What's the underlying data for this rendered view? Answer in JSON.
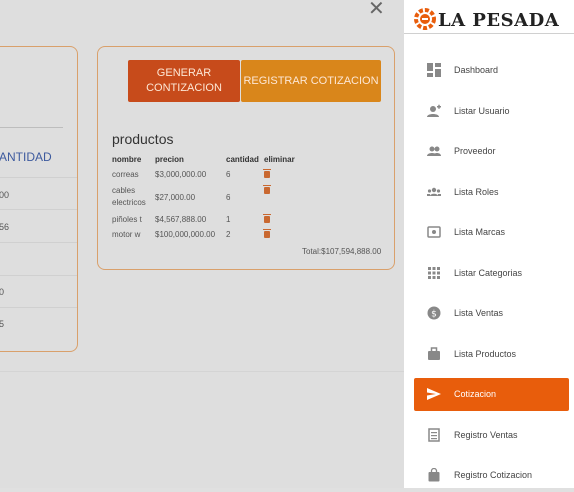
{
  "left_card": {
    "header": "ANTIDAD",
    "cells": [
      "00",
      "56",
      "",
      "0",
      "5"
    ]
  },
  "cotizacion": {
    "generate_label_1": "GENERAR",
    "generate_label_2": "CONTIZACION",
    "register_label": "REGISTRAR COTIZACION",
    "products_title": "productos",
    "columns": [
      "nombre",
      "precion",
      "cantidad",
      "eliminar"
    ],
    "rows": [
      {
        "name": "correas",
        "price": "$3,000,000.00",
        "qty": "6"
      },
      {
        "name": "cables electricos",
        "price": "$27,000.00",
        "qty": "6"
      },
      {
        "name": "piñoles t",
        "price": "$4,567,888.00",
        "qty": "1"
      },
      {
        "name": "motor w",
        "price": "$100,000,000.00",
        "qty": "2"
      }
    ],
    "total": "Total:$107,594,888.00"
  },
  "sidebar": {
    "brand": "LA PESADA",
    "brand_color": "#e85d0c",
    "items": [
      {
        "label": "Dashboard",
        "icon": "dashboard-icon"
      },
      {
        "label": "Listar Usuario",
        "icon": "person-add-icon"
      },
      {
        "label": "Proveedor",
        "icon": "group-icon"
      },
      {
        "label": "Lista Roles",
        "icon": "groups-icon"
      },
      {
        "label": "Lista Marcas",
        "icon": "branding-icon"
      },
      {
        "label": "Listar Categorias",
        "icon": "grid-icon"
      },
      {
        "label": "Lista Ventas",
        "icon": "dollar-icon"
      },
      {
        "label": "Lista Productos",
        "icon": "bag-icon"
      },
      {
        "label": "Cotizacion",
        "icon": "send-icon",
        "active": true
      },
      {
        "label": "Registro Ventas",
        "icon": "receipt-icon"
      },
      {
        "label": "Registro Cotizacion",
        "icon": "shopping-bag-icon"
      }
    ]
  }
}
